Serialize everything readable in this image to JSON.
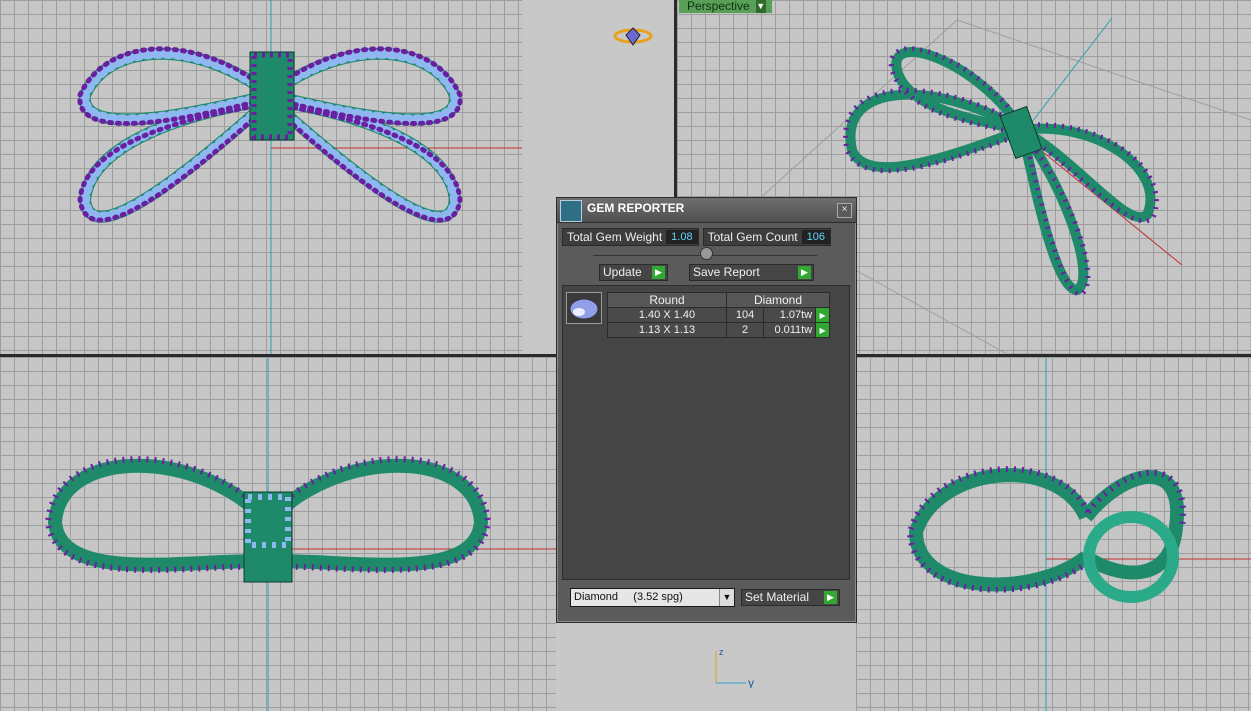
{
  "viewports": {
    "perspective_label": "Perspective",
    "axis_y_label": "y",
    "axis_z_label": "z"
  },
  "gem_reporter": {
    "title": "GEM REPORTER",
    "close_label": "×",
    "total_weight_label": "Total Gem Weight",
    "total_weight_value": "1.08",
    "total_count_label": "Total Gem Count",
    "total_count_value": "106",
    "update_label": "Update",
    "save_report_label": "Save Report",
    "table": {
      "headers": [
        "Round",
        "Diamond"
      ],
      "rows": [
        {
          "size": "1.40 X 1.40",
          "count": "104",
          "weight": "1.07tw"
        },
        {
          "size": "1.13 X 1.13",
          "count": "2",
          "weight": "0.011tw"
        }
      ]
    },
    "material_select": "Diamond     (3.52 spg)",
    "set_material_label": "Set Material"
  },
  "colors": {
    "metal": "#1f8a6a",
    "gem": "#8fb8f0",
    "prong": "#6a1fa0",
    "axis_red": "#c03030",
    "axis_cyan": "#30a0b0"
  }
}
